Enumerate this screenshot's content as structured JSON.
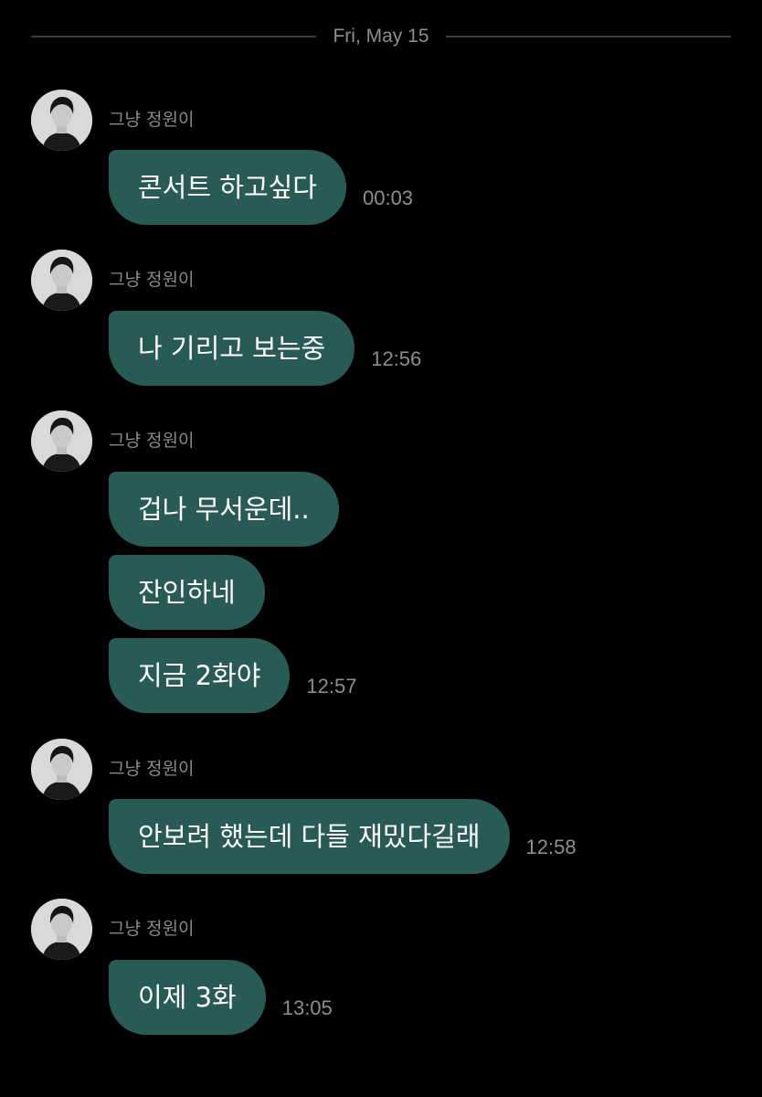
{
  "date_divider": "Fri, May 15",
  "sender_name": "그냥 정원이",
  "groups": [
    {
      "messages": [
        {
          "text": "콘서트 하고싶다",
          "time": "00:03"
        }
      ]
    },
    {
      "messages": [
        {
          "text": "나 기리고 보는중",
          "time": "12:56"
        }
      ]
    },
    {
      "messages": [
        {
          "text": "겁나 무서운데..",
          "time": ""
        },
        {
          "text": "잔인하네",
          "time": ""
        },
        {
          "text": "지금 2화야",
          "time": "12:57"
        }
      ]
    },
    {
      "messages": [
        {
          "text": "안보려 했는데 다들 재밌다길래",
          "time": "12:58"
        }
      ]
    },
    {
      "messages": [
        {
          "text": "이제 3화",
          "time": "13:05"
        }
      ]
    }
  ],
  "colors": {
    "background": "#000000",
    "bubble": "#285b56",
    "meta_text": "#8e8e8e"
  },
  "icons": {
    "avatar": "profile-photo-avatar"
  }
}
